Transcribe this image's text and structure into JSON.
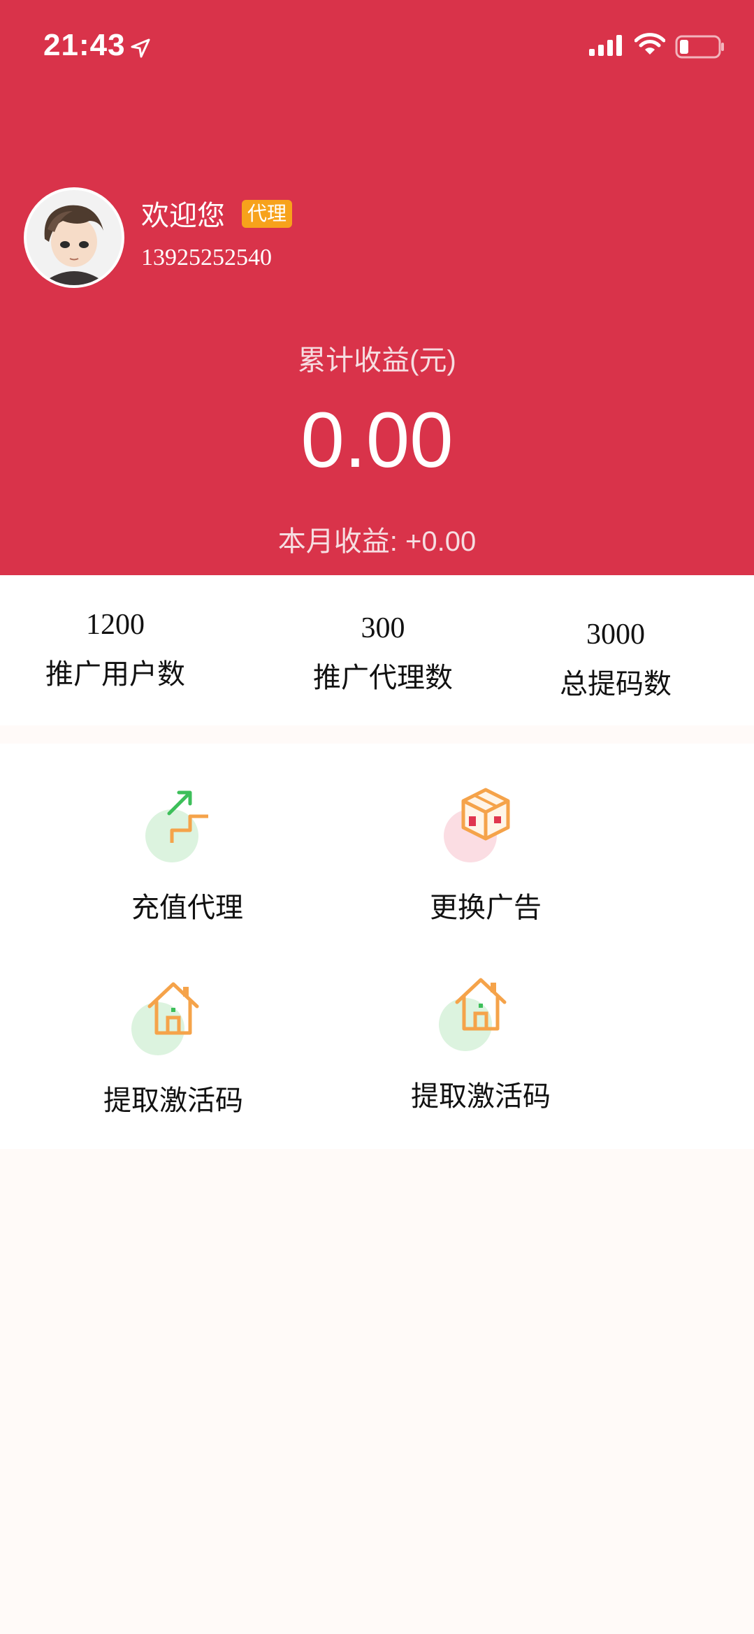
{
  "status_bar": {
    "time": "21:43",
    "location_icon": "location-arrow-icon",
    "signal_icon": "cellular-signal-icon",
    "wifi_icon": "wifi-icon",
    "battery_icon": "battery-low-icon"
  },
  "colors": {
    "header_red": "#d9334a",
    "badge_orange": "#f7a21b",
    "icon_orange": "#f5a34a",
    "icon_green": "#3dbf5a"
  },
  "profile": {
    "welcome": "欢迎您",
    "badge": "代理",
    "phone": "13925252540"
  },
  "earnings": {
    "total_label": "累计收益(元)",
    "total_value": "0.00",
    "month_label": "本月收益: +0.00"
  },
  "stats": [
    {
      "value": "1200",
      "label": "推广用户数"
    },
    {
      "value": "300",
      "label": "推广代理数"
    },
    {
      "value": "3000",
      "label": "总提码数"
    }
  ],
  "grid": [
    {
      "label": "充值代理",
      "icon": "stairs-up-icon"
    },
    {
      "label": "更换广告",
      "icon": "box-icon"
    },
    {
      "label": "提取激活码",
      "icon": "house-icon"
    },
    {
      "label": "提取激活码",
      "icon": "house-icon"
    }
  ]
}
